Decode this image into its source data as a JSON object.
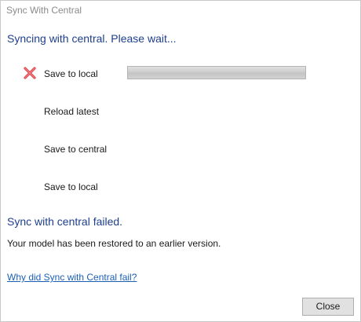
{
  "window": {
    "title": "Sync With Central"
  },
  "status": {
    "heading": "Syncing with central. Please wait..."
  },
  "steps": [
    {
      "label": "Save to local",
      "state": "failed",
      "icon": "red-x-icon",
      "show_progress": true,
      "progress": 1.0
    },
    {
      "label": "Reload latest",
      "state": "pending"
    },
    {
      "label": "Save to central",
      "state": "pending"
    },
    {
      "label": "Save to local",
      "state": "pending"
    }
  ],
  "result": {
    "heading": "Sync with central failed.",
    "detail": "Your model has been restored to an earlier version."
  },
  "help_link": {
    "text": "Why did Sync with Central fail?"
  },
  "buttons": {
    "close_label": "Close"
  },
  "colors": {
    "heading": "#1e3f8c",
    "link": "#1a5fb4",
    "error_icon": "#e0454a"
  }
}
